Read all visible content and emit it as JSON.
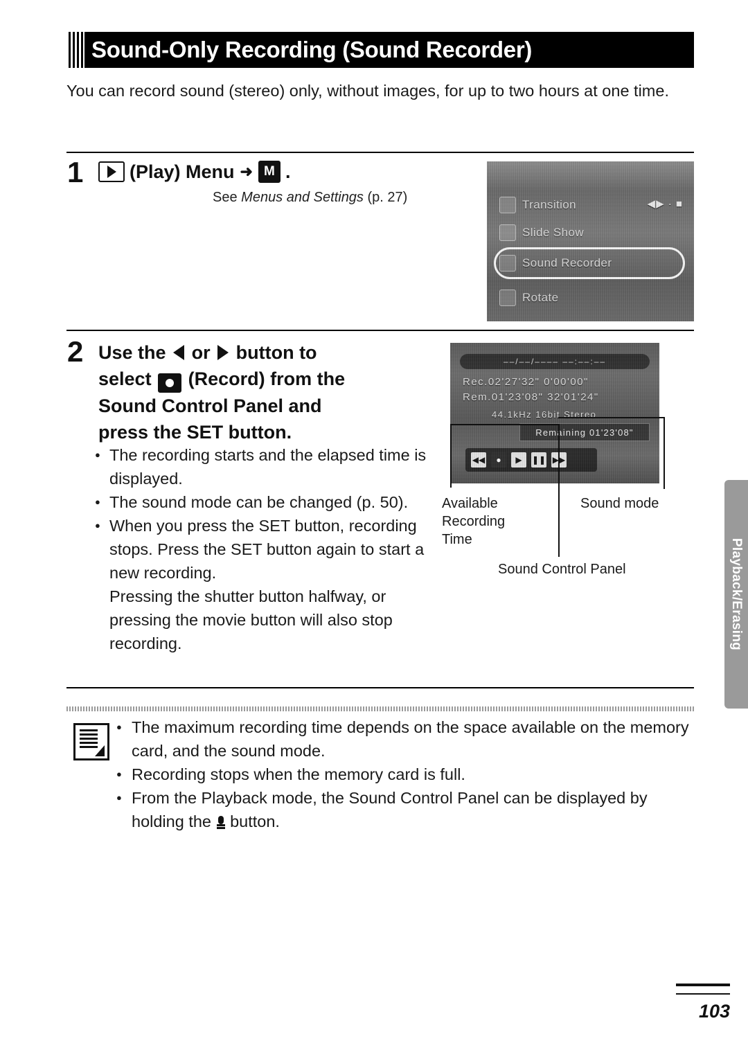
{
  "page": {
    "number": "103",
    "side_tab": "Playback/Erasing"
  },
  "title": "Sound-Only Recording (Sound Recorder)",
  "intro": "You can record sound (stereo) only, without images, for up to two hours at one time.",
  "steps": [
    {
      "number": "1",
      "heading_pre": "",
      "heading_text": "(Play) Menu",
      "heading_post": ".",
      "icon_play": "play-icon",
      "arrow": "➜",
      "icon_menu": "MENU",
      "subnote_prefix": "See ",
      "subnote_italic": "Menus and Settings",
      "subnote_suffix": " (p. 27)"
    },
    {
      "number": "2",
      "line1_a": "Use the",
      "line1_b": "or",
      "line1_c": "button to",
      "line2_a": "select",
      "line2_b": "(Record) from the",
      "line3": "Sound Control Panel and",
      "line4_a": "press the",
      "line4_b": "SET",
      "line4_c": "button."
    }
  ],
  "step2_bullets": [
    "The recording starts and the elapsed time is displayed.",
    "The sound mode can be changed (p. 50).",
    "When you press the SET button, recording stops. Press the SET button again to start a new recording.",
    "Pressing the shutter button halfway, or pressing the movie button will also stop recording."
  ],
  "callouts": {
    "available_recording_time": "Available\nRecording\nTime",
    "sound_mode": "Sound mode",
    "sound_control_panel": "Sound Control Panel"
  },
  "lcd1": {
    "rows": [
      {
        "label": "Transition",
        "value": "◀▶ · ■"
      },
      {
        "label": "Slide Show",
        "value": ""
      },
      {
        "label": "Sound Recorder",
        "value": ""
      },
      {
        "label": "Rotate",
        "value": ""
      }
    ]
  },
  "lcd2": {
    "top_bar": "––/––/––––  ––:––:––",
    "line1": "Rec.02'27'32\"  0'00'00\"",
    "line2": "Rem.01'23'08\"  32'01'24\"",
    "line3": "44.1kHz  16bit  Stereo",
    "time_box": "Remaining 01'23'08\"",
    "buttons": [
      "prev",
      "record",
      "play",
      "pause",
      "next"
    ]
  },
  "notes": [
    "The maximum recording time depends on the space available on the memory card, and the sound mode.",
    "Recording stops when the memory card is full.",
    "From the Playback mode, the Sound Control Panel can be displayed by holding the",
    "button."
  ]
}
